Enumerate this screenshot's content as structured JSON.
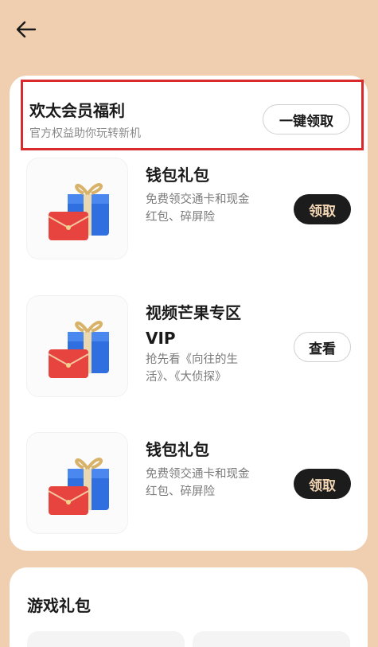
{
  "header": {
    "title": "欢太会员福利",
    "subtitle": "官方权益助你玩转新机",
    "claim_all_label": "一键领取"
  },
  "items": [
    {
      "title": "钱包礼包",
      "desc_line1": "免费领交通卡和现金",
      "desc_line2": "红包、碎屏险",
      "button": "领取",
      "icon": "gift-icon"
    },
    {
      "title_line1": "视频芒果专区",
      "title_line2": "VIP",
      "desc_line1": "抢先看《向往的生",
      "desc_line2": "活》、《大侦探》",
      "button": "查看",
      "icon": "gift-icon"
    },
    {
      "title": "钱包礼包",
      "desc_line1": "免费领交通卡和现金",
      "desc_line2": "红包、碎屏险",
      "button": "领取",
      "icon": "gift-icon"
    }
  ],
  "games": {
    "title": "游戏礼包"
  },
  "colors": {
    "background": "#f0cfb1",
    "highlight_border": "#d92b2b",
    "dark_button": "#1c1c1c",
    "dark_button_text": "#f3d6b4"
  }
}
